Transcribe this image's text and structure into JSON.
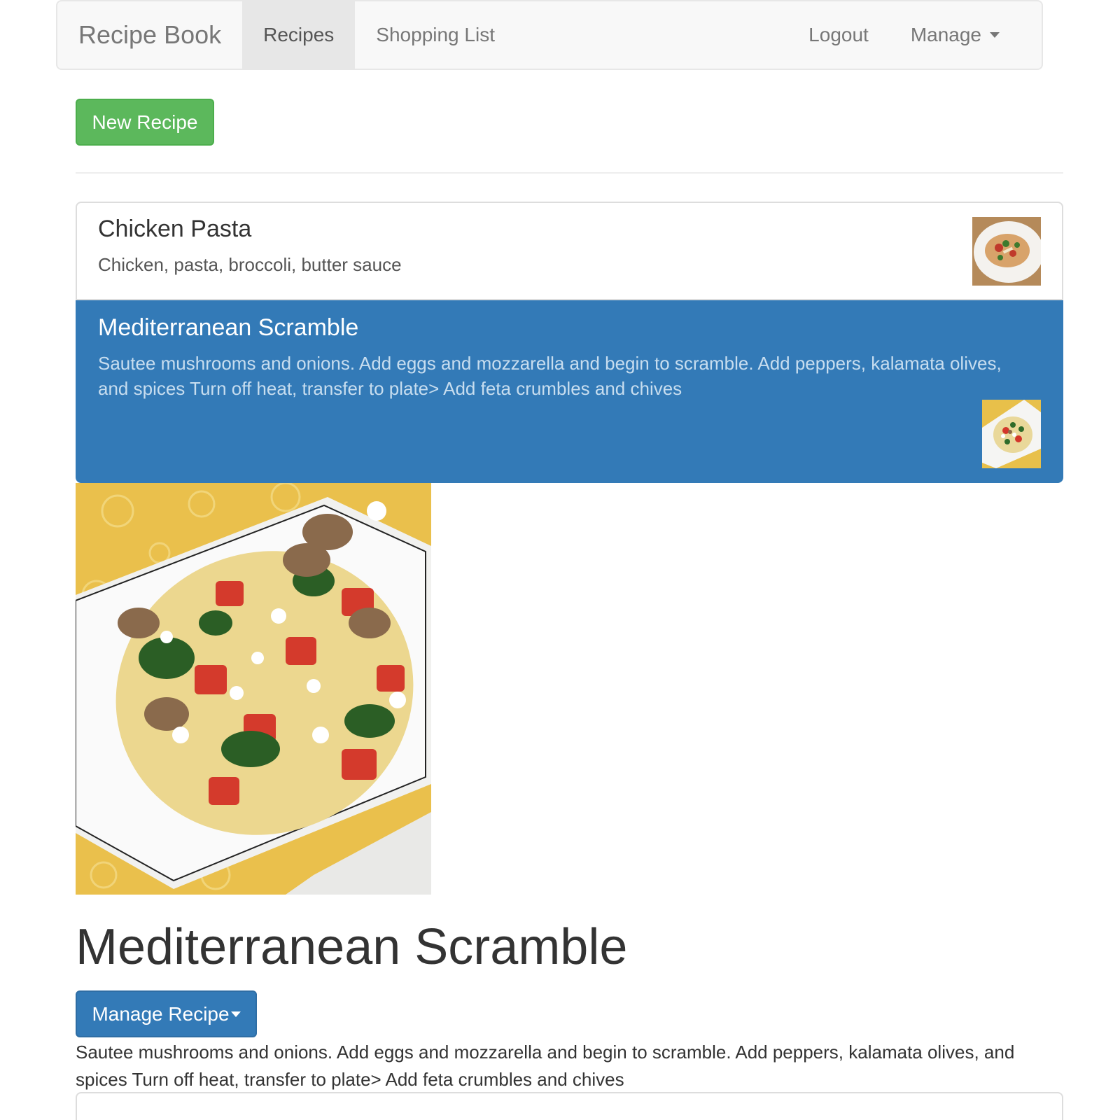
{
  "navbar": {
    "brand": "Recipe Book",
    "tabs": [
      {
        "label": "Recipes",
        "active": true
      },
      {
        "label": "Shopping List",
        "active": false
      }
    ],
    "logout_label": "Logout",
    "manage_label": "Manage"
  },
  "actions": {
    "new_recipe_label": "New Recipe"
  },
  "recipes": [
    {
      "name": "Chicken Pasta",
      "description": "Chicken, pasta, broccoli, butter sauce",
      "thumbnail": "chicken-pasta-photo",
      "selected": false
    },
    {
      "name": "Mediterranean Scramble",
      "description": "Sautee mushrooms and onions. Add eggs and mozzarella and begin to scramble. Add peppers, kalamata olives, and spices Turn off heat, transfer to plate> Add feta crumbles and chives",
      "thumbnail": "mediterranean-scramble-photo",
      "selected": true
    }
  ],
  "detail": {
    "title": "Mediterranean Scramble",
    "manage_button_label": "Manage Recipe",
    "description": "Sautee mushrooms and onions. Add eggs and mozzarella and begin to scramble. Add peppers, kalamata olives, and spices Turn off heat, transfer to plate> Add feta crumbles and chives"
  },
  "colors": {
    "success": "#5cb85c",
    "primary": "#337ab7",
    "navbar_bg": "#f8f8f8"
  }
}
